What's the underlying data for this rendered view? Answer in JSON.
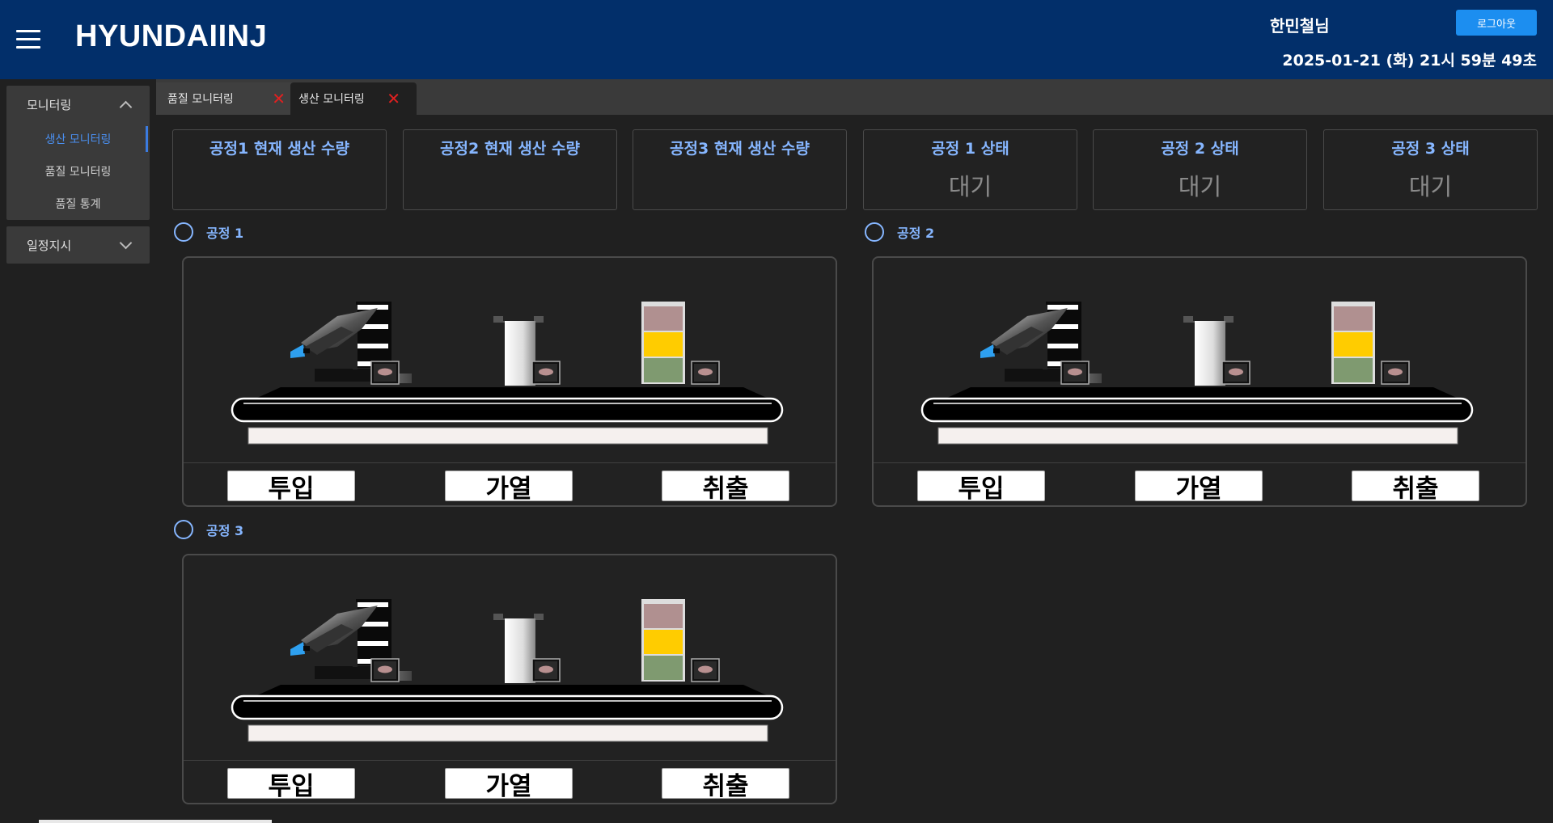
{
  "header": {
    "brand": "HYUNDAIINJ",
    "username": "한민철님",
    "logout_label": "로그아웃",
    "datetime": "2025-01-21 (화) 21시 59분 49초"
  },
  "sidebar": {
    "groups": [
      {
        "label": "모니터링",
        "expanded": true,
        "items": [
          {
            "label": "생산 모니터링",
            "active": true
          },
          {
            "label": "품질 모니터링"
          },
          {
            "label": "품질 통계"
          }
        ]
      },
      {
        "label": "일정지시",
        "expanded": false
      }
    ]
  },
  "tabs": [
    {
      "label": "품질 모니터링",
      "active": false
    },
    {
      "label": "생산 모니터링",
      "active": true
    }
  ],
  "cards": [
    {
      "title": "공정1 현재 생산 수량",
      "value": ""
    },
    {
      "title": "공정2 현재 생산 수량",
      "value": ""
    },
    {
      "title": "공정3 현재 생산 수량",
      "value": ""
    },
    {
      "title": "공정 1 상태",
      "value": "대기"
    },
    {
      "title": "공정 2 상태",
      "value": "대기"
    },
    {
      "title": "공정 3 상태",
      "value": "대기"
    }
  ],
  "processes": [
    {
      "label": "공정 1",
      "buttons": [
        "투입",
        "가열",
        "취출"
      ]
    },
    {
      "label": "공정 2",
      "buttons": [
        "투입",
        "가열",
        "취출"
      ]
    },
    {
      "label": "공정 3",
      "buttons": [
        "투입",
        "가열",
        "취출"
      ]
    }
  ],
  "colors": {
    "header_bg": "#022f6a",
    "accent_blue": "#1c8ef0",
    "label_blue": "#86b6ff",
    "close_red": "#e02020",
    "light_red": "#b09090",
    "light_yellow": "#ffcc00",
    "light_green": "#7f9a70",
    "robot_nozzle": "#2ea0f0"
  },
  "icons": [
    "hamburger-icon",
    "chevron-up-icon",
    "chevron-down-icon",
    "close-icon",
    "radio-icon"
  ]
}
